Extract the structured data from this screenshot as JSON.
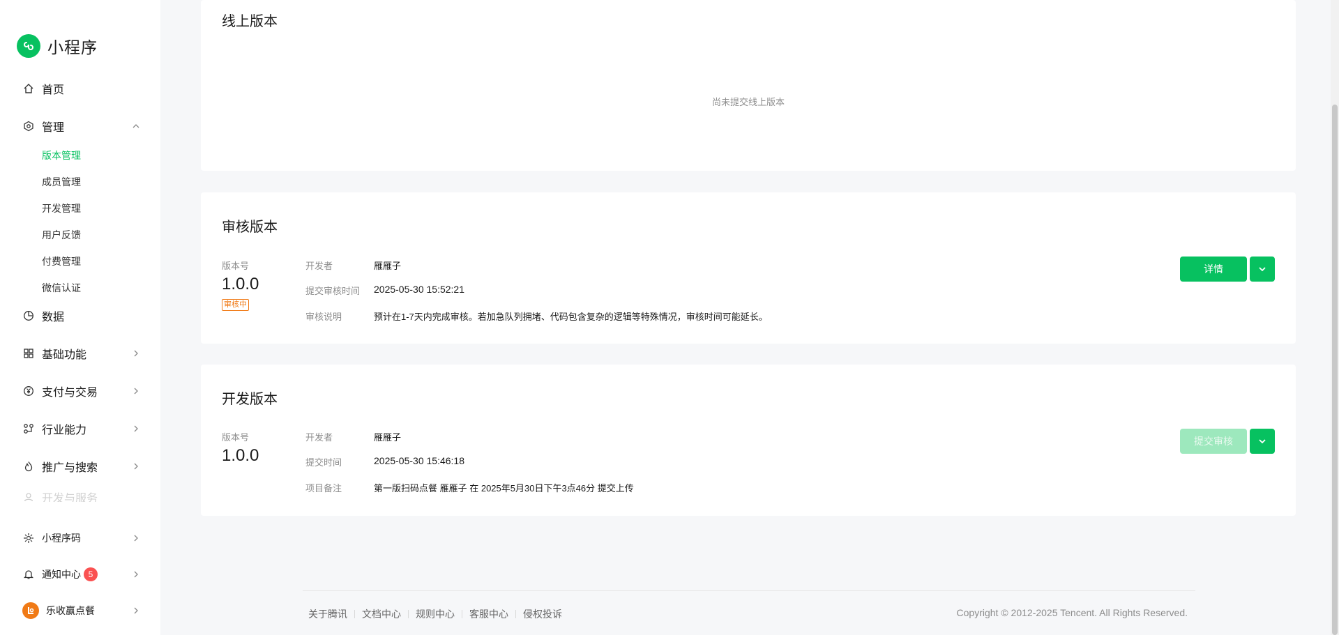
{
  "brand": {
    "name": "小程序",
    "icon": "mini-program-logo"
  },
  "sidebar": {
    "home": "首页",
    "manage": {
      "label": "管理",
      "items": [
        "版本管理",
        "成员管理",
        "开发管理",
        "用户反馈",
        "付费管理",
        "微信认证"
      ],
      "active": "版本管理"
    },
    "data": "数据",
    "basic": "基础功能",
    "payment": "支付与交易",
    "industry": "行业能力",
    "promotion": "推广与搜索",
    "devservice": "开发与服务",
    "qrcode": "小程序码",
    "notify": {
      "label": "通知中心",
      "count": "5"
    },
    "account": "乐收赢点餐"
  },
  "online": {
    "title": "线上版本",
    "empty": "尚未提交线上版本"
  },
  "review": {
    "title": "审核版本",
    "version_label": "版本号",
    "version": "1.0.0",
    "status": "审核中",
    "fields": [
      {
        "label": "开发者",
        "value": "雁雁子"
      },
      {
        "label": "提交审核时间",
        "value": "2025-05-30 15:52:21"
      },
      {
        "label": "审核说明",
        "value": "预计在1-7天内完成审核。若加急队列拥堵、代码包含复杂的逻辑等特殊情况，审核时间可能延长。"
      }
    ],
    "detail_btn": "详情"
  },
  "dev": {
    "title": "开发版本",
    "version_label": "版本号",
    "version": "1.0.0",
    "fields": [
      {
        "label": "开发者",
        "value": "雁雁子"
      },
      {
        "label": "提交时间",
        "value": "2025-05-30 15:46:18"
      },
      {
        "label": "项目备注",
        "value": "第一版扫码点餐 雁雁子 在 2025年5月30日下午3点46分 提交上传"
      }
    ],
    "submit_btn": "提交审核"
  },
  "footer": {
    "links": [
      "关于腾讯",
      "文档中心",
      "规则中心",
      "客服中心",
      "侵权投诉"
    ],
    "copyright": "Copyright © 2012-2025 Tencent. All Rights Reserved."
  },
  "colors": {
    "accent": "#07c160",
    "warning": "#f07a16",
    "badge": "#fa5151"
  }
}
